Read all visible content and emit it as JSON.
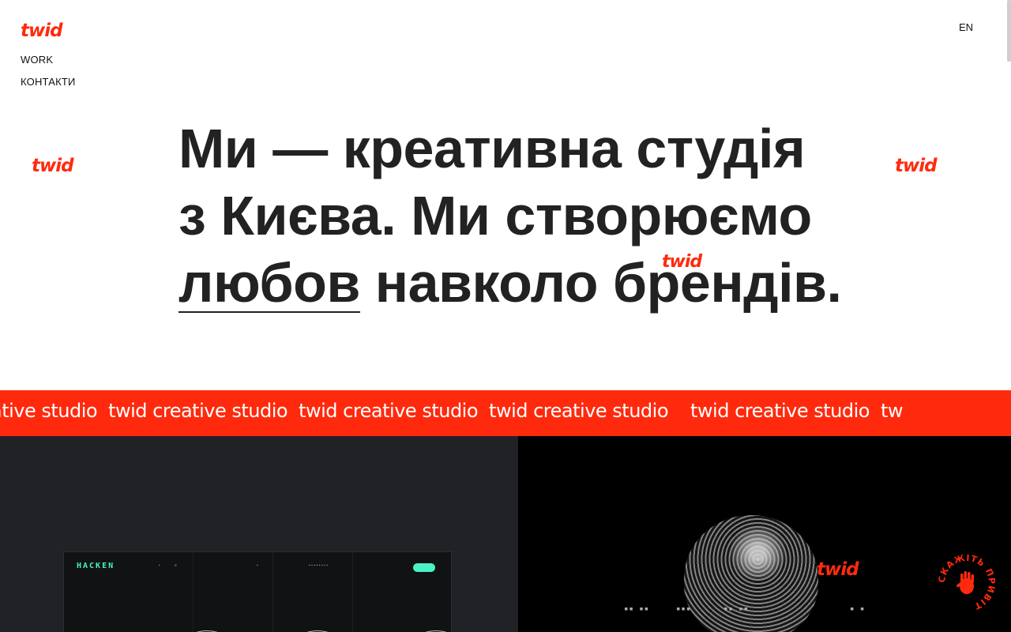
{
  "header": {
    "logo": "twid",
    "nav": [
      {
        "label": "WORK"
      },
      {
        "label": "КОНТАКТИ"
      }
    ],
    "language": "EN"
  },
  "hero": {
    "line1": "Ми — креативна студія",
    "line2": "з Києва. Ми створюємо",
    "line3_underlined": "любов",
    "line3_rest": " навколо брендів.",
    "floating_logos": [
      "twid",
      "twid",
      "twid",
      "twid"
    ]
  },
  "ticker": {
    "text": "twid creative studio",
    "leading_fragment": "ative studio",
    "trailing_fragment": "tw"
  },
  "work": {
    "left_project": {
      "mockup_logo": "HACKEN"
    },
    "right_project": {
      "overlay_logo": "twid"
    }
  },
  "stamp": {
    "text": "СКАЖІТЬ ПРИВІТ"
  },
  "colors": {
    "brand_red": "#ff2a0d",
    "text_dark": "#222222",
    "mockup_accent": "#4af2c4"
  }
}
